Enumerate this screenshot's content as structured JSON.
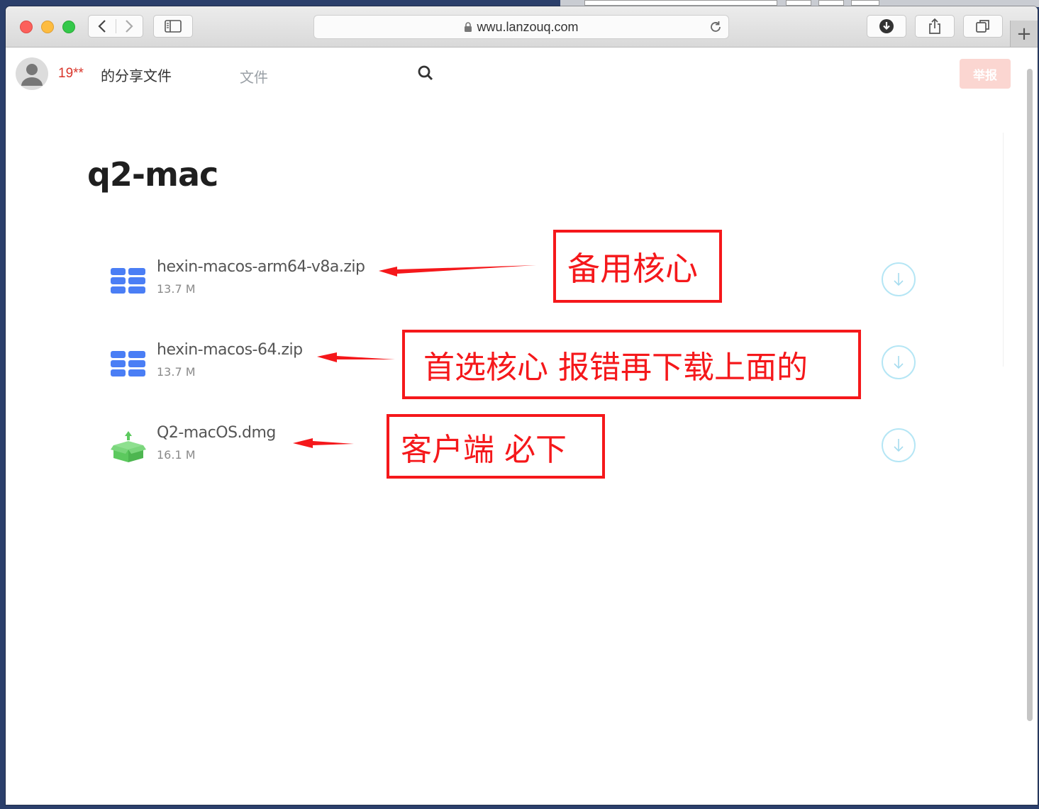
{
  "browser": {
    "url": "wwu.lanzouq.com",
    "new_tab_label": "+"
  },
  "header": {
    "user_name": "19**",
    "share_title": "的分享文件",
    "files_tab": "文件",
    "report_button": "举报"
  },
  "folder": {
    "title": "q2-mac"
  },
  "files": [
    {
      "name": "hexin-macos-arm64-v8a.zip",
      "size": "13.7 M",
      "icon": "zip-archive-icon"
    },
    {
      "name": "hexin-macos-64.zip",
      "size": "13.7 M",
      "icon": "zip-archive-icon"
    },
    {
      "name": "Q2-macOS.dmg",
      "size": "16.1 M",
      "icon": "dmg-package-icon"
    }
  ],
  "annotations": [
    "备用核心",
    "首选核心  报错再下载上面的",
    "客户端  必下"
  ],
  "colors": {
    "accent_red": "#f5181b",
    "zip_blue": "#4a7ef5",
    "dmg_green": "#5cc95e",
    "download_ring": "#b5e6f5"
  }
}
